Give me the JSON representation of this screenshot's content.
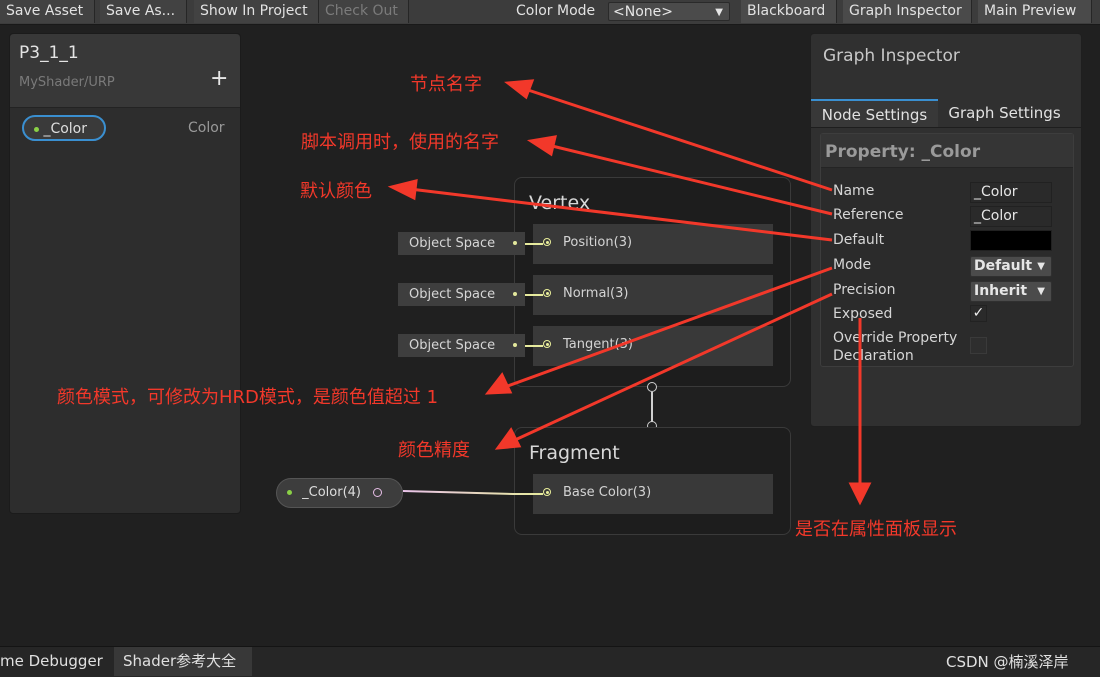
{
  "toolbar": {
    "save_asset": "Save Asset",
    "save_as": "Save As...",
    "show_in_project": "Show In Project",
    "check_out": "Check Out",
    "color_mode_label": "Color Mode",
    "color_mode_value": "<None>",
    "blackboard": "Blackboard",
    "graph_inspector": "Graph Inspector",
    "main_preview": "Main Preview"
  },
  "blackboard": {
    "title": "P3_1_1",
    "subtitle": "MyShader/URP",
    "add_symbol": "+",
    "property_name": "_Color",
    "property_type": "Color"
  },
  "graph": {
    "vertex_title": "Vertex",
    "fragment_title": "Fragment",
    "vertex_slots": [
      "Position(3)",
      "Normal(3)",
      "Tangent(3)"
    ],
    "space_chips": [
      "Object Space",
      "Object Space",
      "Object Space"
    ],
    "fragment_slot": "Base Color(3)",
    "color_node": "_Color(4)"
  },
  "inspector": {
    "title": "Graph Inspector",
    "tab_node": "Node Settings",
    "tab_graph": "Graph Settings",
    "property_header": "Property: _Color",
    "rows": {
      "name": "Name",
      "reference": "Reference",
      "default": "Default",
      "mode": "Mode",
      "precision": "Precision",
      "exposed": "Exposed",
      "override": "Override Property Declaration"
    },
    "values": {
      "name": "_Color",
      "reference": "_Color",
      "default_color": "#000000",
      "mode": "Default",
      "precision": "Inherit",
      "exposed_check": "✓"
    }
  },
  "annotations": {
    "node_name": "节点名字",
    "script_name": "脚本调用时，使用的名字",
    "default_color": "默认颜色",
    "color_mode": "颜色模式，可修改为HRD模式，是颜色值超过 1",
    "color_precision": "颜色精度",
    "exposed": "是否在属性面板显示",
    "annotation_color": "#f2382a"
  },
  "bottom": {
    "tab1": "me Debugger",
    "tab2": "Shader参考大全",
    "watermark": "CSDN @楠溪泽岸"
  }
}
